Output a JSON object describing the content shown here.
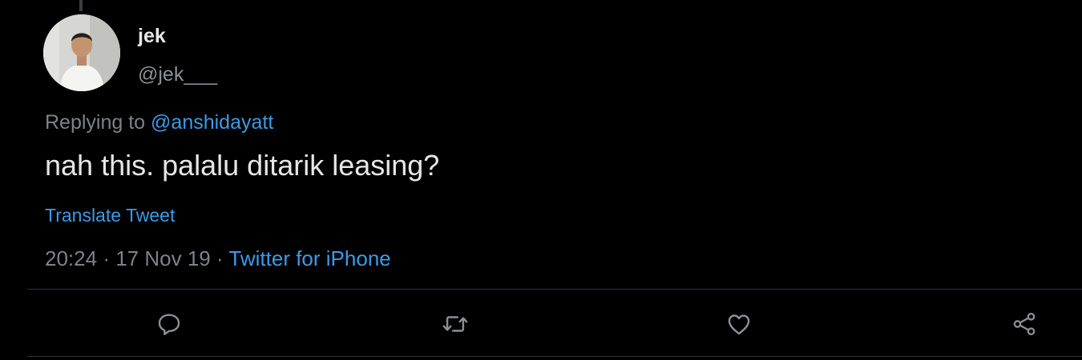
{
  "tweet": {
    "author": {
      "display_name": "jek",
      "handle": "@jek___",
      "avatar": "profile-photo"
    },
    "replying_prefix": "Replying to",
    "replying_to": "@anshidayatt",
    "text": "nah this. palalu ditarik leasing?",
    "translate_label": "Translate Tweet",
    "time": "20:24",
    "date": "17 Nov 19",
    "separator": "·",
    "source": "Twitter for iPhone"
  },
  "actions": [
    {
      "icon": "reply-icon"
    },
    {
      "icon": "retweet-icon"
    },
    {
      "icon": "like-icon"
    },
    {
      "icon": "share-icon"
    }
  ],
  "colors": {
    "background": "#000000",
    "text": "#e6e6e6",
    "secondary": "#7d8288",
    "accent": "#3b9be8",
    "divider": "#2f3336"
  }
}
